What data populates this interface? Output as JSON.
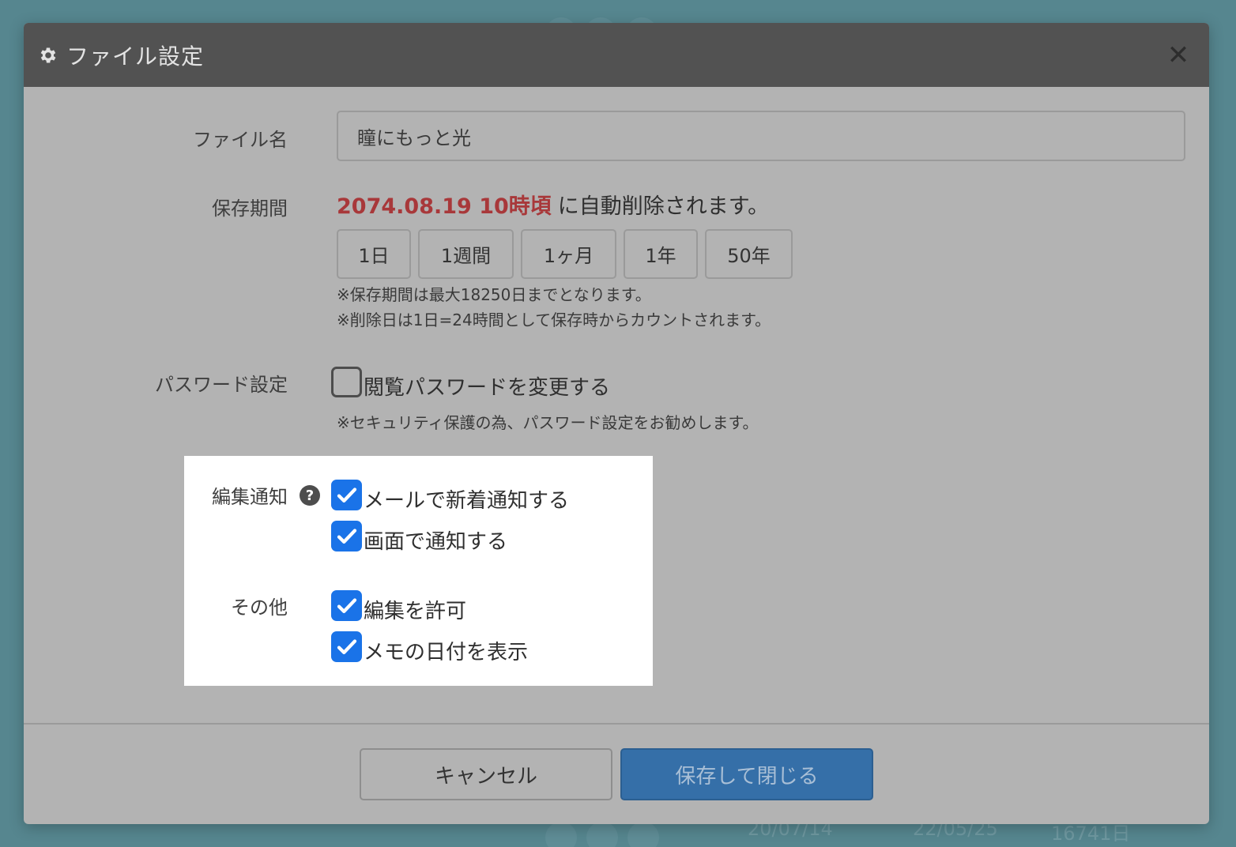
{
  "background": {
    "footer_row": {
      "date1": "20/07/14",
      "date2": "22/05/25",
      "days": "16741日"
    }
  },
  "modal": {
    "title": "ファイル設定",
    "title_icon": "gear-icon",
    "close_icon": "close-icon"
  },
  "filename": {
    "label": "ファイル名",
    "value": "瞳にもっと光"
  },
  "retention": {
    "label": "保存期間",
    "expiry_date": "2074.08.19 10時頃",
    "expiry_suffix": "に自動削除されます。",
    "buttons": [
      "1日",
      "1週間",
      "1ヶ月",
      "1年",
      "50年"
    ],
    "note1": "※保存期間は最大18250日までとなります。",
    "note2": "※削除日は1日=24時間として保存時からカウントされます。"
  },
  "password": {
    "label": "パスワード設定",
    "checkbox_label": "閲覧パスワードを変更する",
    "checked": false,
    "note": "※セキュリティ保護の為、パスワード設定をお勧めします。"
  },
  "edit_notify": {
    "label": "編集通知",
    "help_icon": "question-circle-icon",
    "options": [
      {
        "label": "メールで新着通知する",
        "checked": true
      },
      {
        "label": "画面で通知する",
        "checked": true
      }
    ]
  },
  "other": {
    "label": "その他",
    "options": [
      {
        "label": "編集を許可",
        "checked": true
      },
      {
        "label": "メモの日付を表示",
        "checked": true
      }
    ]
  },
  "footer": {
    "cancel_label": "キャンセル",
    "save_label": "保存して閉じる"
  },
  "colors": {
    "overlay": "#56868f",
    "modal_body": "#b3b3b3",
    "header": "#525252",
    "expiry": "#a8383a",
    "checkbox_checked": "#1a73e8",
    "primary_button": "#356fa8",
    "highlight": "#ffffff"
  }
}
